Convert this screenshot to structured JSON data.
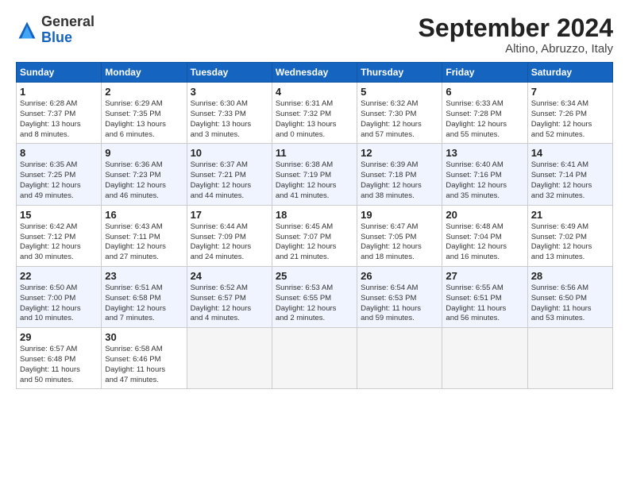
{
  "logo": {
    "general": "General",
    "blue": "Blue"
  },
  "title": "September 2024",
  "location": "Altino, Abruzzo, Italy",
  "days_header": [
    "Sunday",
    "Monday",
    "Tuesday",
    "Wednesday",
    "Thursday",
    "Friday",
    "Saturday"
  ],
  "weeks": [
    [
      {
        "day": "1",
        "detail": "Sunrise: 6:28 AM\nSunset: 7:37 PM\nDaylight: 13 hours\nand 8 minutes."
      },
      {
        "day": "2",
        "detail": "Sunrise: 6:29 AM\nSunset: 7:35 PM\nDaylight: 13 hours\nand 6 minutes."
      },
      {
        "day": "3",
        "detail": "Sunrise: 6:30 AM\nSunset: 7:33 PM\nDaylight: 13 hours\nand 3 minutes."
      },
      {
        "day": "4",
        "detail": "Sunrise: 6:31 AM\nSunset: 7:32 PM\nDaylight: 13 hours\nand 0 minutes."
      },
      {
        "day": "5",
        "detail": "Sunrise: 6:32 AM\nSunset: 7:30 PM\nDaylight: 12 hours\nand 57 minutes."
      },
      {
        "day": "6",
        "detail": "Sunrise: 6:33 AM\nSunset: 7:28 PM\nDaylight: 12 hours\nand 55 minutes."
      },
      {
        "day": "7",
        "detail": "Sunrise: 6:34 AM\nSunset: 7:26 PM\nDaylight: 12 hours\nand 52 minutes."
      }
    ],
    [
      {
        "day": "8",
        "detail": "Sunrise: 6:35 AM\nSunset: 7:25 PM\nDaylight: 12 hours\nand 49 minutes."
      },
      {
        "day": "9",
        "detail": "Sunrise: 6:36 AM\nSunset: 7:23 PM\nDaylight: 12 hours\nand 46 minutes."
      },
      {
        "day": "10",
        "detail": "Sunrise: 6:37 AM\nSunset: 7:21 PM\nDaylight: 12 hours\nand 44 minutes."
      },
      {
        "day": "11",
        "detail": "Sunrise: 6:38 AM\nSunset: 7:19 PM\nDaylight: 12 hours\nand 41 minutes."
      },
      {
        "day": "12",
        "detail": "Sunrise: 6:39 AM\nSunset: 7:18 PM\nDaylight: 12 hours\nand 38 minutes."
      },
      {
        "day": "13",
        "detail": "Sunrise: 6:40 AM\nSunset: 7:16 PM\nDaylight: 12 hours\nand 35 minutes."
      },
      {
        "day": "14",
        "detail": "Sunrise: 6:41 AM\nSunset: 7:14 PM\nDaylight: 12 hours\nand 32 minutes."
      }
    ],
    [
      {
        "day": "15",
        "detail": "Sunrise: 6:42 AM\nSunset: 7:12 PM\nDaylight: 12 hours\nand 30 minutes."
      },
      {
        "day": "16",
        "detail": "Sunrise: 6:43 AM\nSunset: 7:11 PM\nDaylight: 12 hours\nand 27 minutes."
      },
      {
        "day": "17",
        "detail": "Sunrise: 6:44 AM\nSunset: 7:09 PM\nDaylight: 12 hours\nand 24 minutes."
      },
      {
        "day": "18",
        "detail": "Sunrise: 6:45 AM\nSunset: 7:07 PM\nDaylight: 12 hours\nand 21 minutes."
      },
      {
        "day": "19",
        "detail": "Sunrise: 6:47 AM\nSunset: 7:05 PM\nDaylight: 12 hours\nand 18 minutes."
      },
      {
        "day": "20",
        "detail": "Sunrise: 6:48 AM\nSunset: 7:04 PM\nDaylight: 12 hours\nand 16 minutes."
      },
      {
        "day": "21",
        "detail": "Sunrise: 6:49 AM\nSunset: 7:02 PM\nDaylight: 12 hours\nand 13 minutes."
      }
    ],
    [
      {
        "day": "22",
        "detail": "Sunrise: 6:50 AM\nSunset: 7:00 PM\nDaylight: 12 hours\nand 10 minutes."
      },
      {
        "day": "23",
        "detail": "Sunrise: 6:51 AM\nSunset: 6:58 PM\nDaylight: 12 hours\nand 7 minutes."
      },
      {
        "day": "24",
        "detail": "Sunrise: 6:52 AM\nSunset: 6:57 PM\nDaylight: 12 hours\nand 4 minutes."
      },
      {
        "day": "25",
        "detail": "Sunrise: 6:53 AM\nSunset: 6:55 PM\nDaylight: 12 hours\nand 2 minutes."
      },
      {
        "day": "26",
        "detail": "Sunrise: 6:54 AM\nSunset: 6:53 PM\nDaylight: 11 hours\nand 59 minutes."
      },
      {
        "day": "27",
        "detail": "Sunrise: 6:55 AM\nSunset: 6:51 PM\nDaylight: 11 hours\nand 56 minutes."
      },
      {
        "day": "28",
        "detail": "Sunrise: 6:56 AM\nSunset: 6:50 PM\nDaylight: 11 hours\nand 53 minutes."
      }
    ],
    [
      {
        "day": "29",
        "detail": "Sunrise: 6:57 AM\nSunset: 6:48 PM\nDaylight: 11 hours\nand 50 minutes."
      },
      {
        "day": "30",
        "detail": "Sunrise: 6:58 AM\nSunset: 6:46 PM\nDaylight: 11 hours\nand 47 minutes."
      },
      null,
      null,
      null,
      null,
      null
    ]
  ]
}
